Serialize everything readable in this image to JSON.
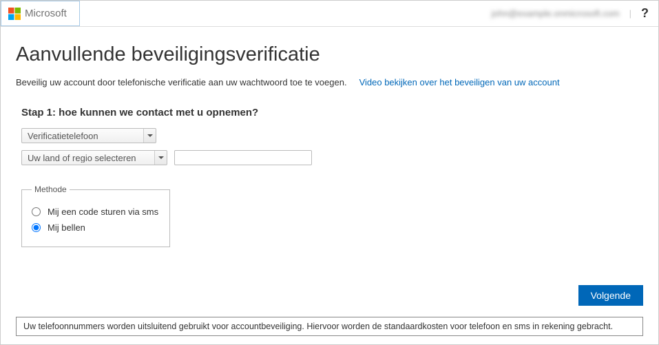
{
  "header": {
    "brand": "Microsoft",
    "user_email": "john@example.onmicrosoft.com",
    "help": "?"
  },
  "page": {
    "title": "Aanvullende beveiligingsverificatie",
    "intro_text": "Beveilig uw account door telefonische verificatie aan uw wachtwoord toe te voegen.",
    "video_link": "Video bekijken over het beveiligen van uw account"
  },
  "step": {
    "title": "Stap 1: hoe kunnen we contact met u opnemen?",
    "contact_method_selected": "Verificatietelefoon",
    "country_placeholder": "Uw land of regio selecteren",
    "phone_value": ""
  },
  "method": {
    "legend": "Methode",
    "option_sms": "Mij een code sturen via sms",
    "option_call": "Mij bellen",
    "selected": "call"
  },
  "buttons": {
    "next": "Volgende"
  },
  "footer_note": "Uw telefoonnummers worden uitsluitend gebruikt voor accountbeveiliging. Hiervoor worden de standaardkosten voor telefoon en sms in rekening gebracht."
}
